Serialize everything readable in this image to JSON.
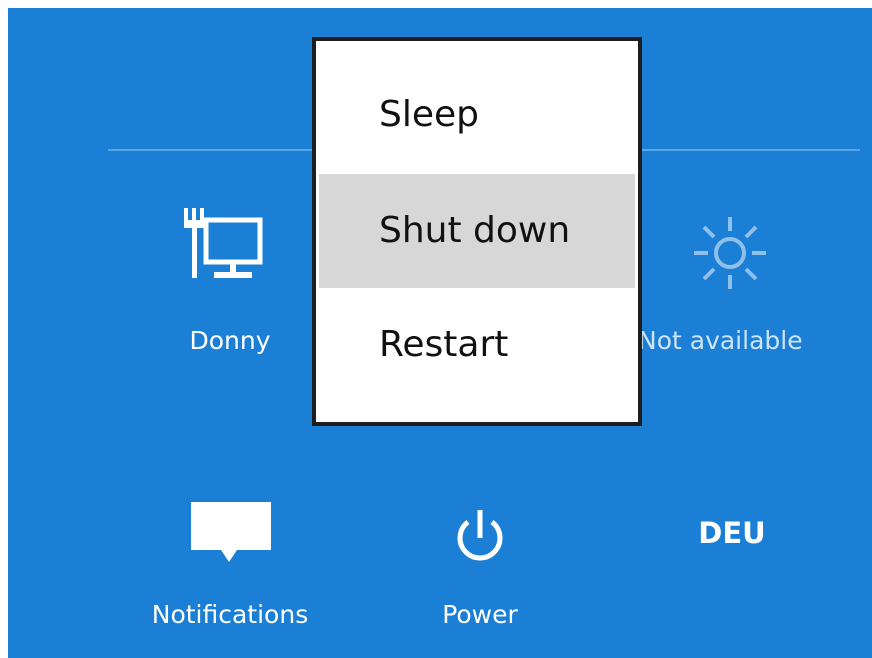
{
  "network": {
    "label": "Donny",
    "icon": "ethernet-network-icon"
  },
  "brightness": {
    "label": "Not available",
    "icon": "brightness-sun-icon"
  },
  "notifications": {
    "label": "Notifications",
    "icon": "notifications-icon"
  },
  "power": {
    "label": "Power",
    "icon": "power-icon"
  },
  "keyboard": {
    "label": "DEU"
  },
  "power_menu": {
    "items": [
      {
        "label": "Sleep"
      },
      {
        "label": "Shut down",
        "highlighted": true
      },
      {
        "label": "Restart"
      }
    ]
  },
  "colors": {
    "panel_background": "#1b7fd6",
    "menu_highlight": "#d7d7d7"
  }
}
